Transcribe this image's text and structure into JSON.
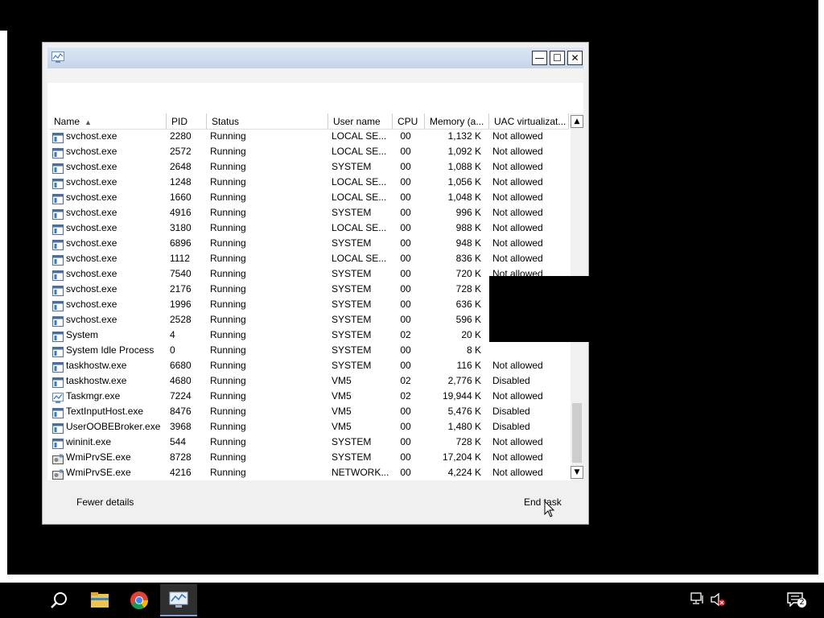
{
  "window": {
    "title": "",
    "minimize_glyph": "—",
    "maximize_glyph": "☐",
    "close_glyph": "✕"
  },
  "table": {
    "columns": [
      "Name",
      "PID",
      "Status",
      "User name",
      "CPU",
      "Memory (a...",
      "UAC virtualizat..."
    ],
    "sort_column": "Name",
    "rows": [
      {
        "icon": "service-icon",
        "name": "svchost.exe",
        "pid": "2280",
        "status": "Running",
        "user": "LOCAL SE...",
        "cpu": "00",
        "mem": "1,132 K",
        "uac": "Not allowed"
      },
      {
        "icon": "service-icon",
        "name": "svchost.exe",
        "pid": "2572",
        "status": "Running",
        "user": "LOCAL SE...",
        "cpu": "00",
        "mem": "1,092 K",
        "uac": "Not allowed"
      },
      {
        "icon": "service-icon",
        "name": "svchost.exe",
        "pid": "2648",
        "status": "Running",
        "user": "SYSTEM",
        "cpu": "00",
        "mem": "1,088 K",
        "uac": "Not allowed"
      },
      {
        "icon": "service-icon",
        "name": "svchost.exe",
        "pid": "1248",
        "status": "Running",
        "user": "LOCAL SE...",
        "cpu": "00",
        "mem": "1,056 K",
        "uac": "Not allowed"
      },
      {
        "icon": "service-icon",
        "name": "svchost.exe",
        "pid": "1660",
        "status": "Running",
        "user": "LOCAL SE...",
        "cpu": "00",
        "mem": "1,048 K",
        "uac": "Not allowed"
      },
      {
        "icon": "service-icon",
        "name": "svchost.exe",
        "pid": "4916",
        "status": "Running",
        "user": "SYSTEM",
        "cpu": "00",
        "mem": "996 K",
        "uac": "Not allowed"
      },
      {
        "icon": "service-icon",
        "name": "svchost.exe",
        "pid": "3180",
        "status": "Running",
        "user": "LOCAL SE...",
        "cpu": "00",
        "mem": "988 K",
        "uac": "Not allowed"
      },
      {
        "icon": "service-icon",
        "name": "svchost.exe",
        "pid": "6896",
        "status": "Running",
        "user": "SYSTEM",
        "cpu": "00",
        "mem": "948 K",
        "uac": "Not allowed"
      },
      {
        "icon": "service-icon",
        "name": "svchost.exe",
        "pid": "1112",
        "status": "Running",
        "user": "LOCAL SE...",
        "cpu": "00",
        "mem": "836 K",
        "uac": "Not allowed"
      },
      {
        "icon": "service-icon",
        "name": "svchost.exe",
        "pid": "7540",
        "status": "Running",
        "user": "SYSTEM",
        "cpu": "00",
        "mem": "720 K",
        "uac": "Not allowed"
      },
      {
        "icon": "service-icon",
        "name": "svchost.exe",
        "pid": "2176",
        "status": "Running",
        "user": "SYSTEM",
        "cpu": "00",
        "mem": "728 K",
        "uac": ""
      },
      {
        "icon": "service-icon",
        "name": "svchost.exe",
        "pid": "1996",
        "status": "Running",
        "user": "SYSTEM",
        "cpu": "00",
        "mem": "636 K",
        "uac": ""
      },
      {
        "icon": "service-icon",
        "name": "svchost.exe",
        "pid": "2528",
        "status": "Running",
        "user": "SYSTEM",
        "cpu": "00",
        "mem": "596 K",
        "uac": ""
      },
      {
        "icon": "service-icon",
        "name": "System",
        "pid": "4",
        "status": "Running",
        "user": "SYSTEM",
        "cpu": "02",
        "mem": "20 K",
        "uac": ""
      },
      {
        "icon": "service-icon",
        "name": "System Idle Process",
        "pid": "0",
        "status": "Running",
        "user": "SYSTEM",
        "cpu": "00",
        "mem": "8 K",
        "uac": ""
      },
      {
        "icon": "service-icon",
        "name": "taskhostw.exe",
        "pid": "6680",
        "status": "Running",
        "user": "SYSTEM",
        "cpu": "00",
        "mem": "116 K",
        "uac": "Not allowed"
      },
      {
        "icon": "service-icon",
        "name": "taskhostw.exe",
        "pid": "4680",
        "status": "Running",
        "user": "VM5",
        "cpu": "02",
        "mem": "2,776 K",
        "uac": "Disabled"
      },
      {
        "icon": "taskmgr-icon",
        "name": "Taskmgr.exe",
        "pid": "7224",
        "status": "Running",
        "user": "VM5",
        "cpu": "02",
        "mem": "19,944 K",
        "uac": "Not allowed"
      },
      {
        "icon": "service-icon",
        "name": "TextInputHost.exe",
        "pid": "8476",
        "status": "Running",
        "user": "VM5",
        "cpu": "00",
        "mem": "5,476 K",
        "uac": "Disabled"
      },
      {
        "icon": "service-icon",
        "name": "UserOOBEBroker.exe",
        "pid": "3968",
        "status": "Running",
        "user": "VM5",
        "cpu": "00",
        "mem": "1,480 K",
        "uac": "Disabled"
      },
      {
        "icon": "service-icon",
        "name": "wininit.exe",
        "pid": "544",
        "status": "Running",
        "user": "SYSTEM",
        "cpu": "00",
        "mem": "728 K",
        "uac": "Not allowed"
      },
      {
        "icon": "wmi-icon",
        "name": "WmiPrvSE.exe",
        "pid": "8728",
        "status": "Running",
        "user": "SYSTEM",
        "cpu": "00",
        "mem": "17,204 K",
        "uac": "Not allowed"
      },
      {
        "icon": "wmi-icon",
        "name": "WmiPrvSE.exe",
        "pid": "4216",
        "status": "Running",
        "user": "NETWORK...",
        "cpu": "00",
        "mem": "4,224 K",
        "uac": "Not allowed"
      }
    ]
  },
  "footer": {
    "fewer_details": "Fewer details",
    "end_task": "End task"
  },
  "taskbar": {
    "items": [
      "search-icon",
      "file-explorer-icon",
      "chrome-icon",
      "task-manager-icon"
    ],
    "tray": [
      "network-icon",
      "volume-muted-icon",
      "notifications-icon"
    ],
    "notification_count": "2"
  },
  "colors": {
    "titlebar": "#c4d5ea",
    "window_bg": "#f0f0f0",
    "taskbar": "#000000",
    "active_task_underline": "#7aa7de"
  }
}
